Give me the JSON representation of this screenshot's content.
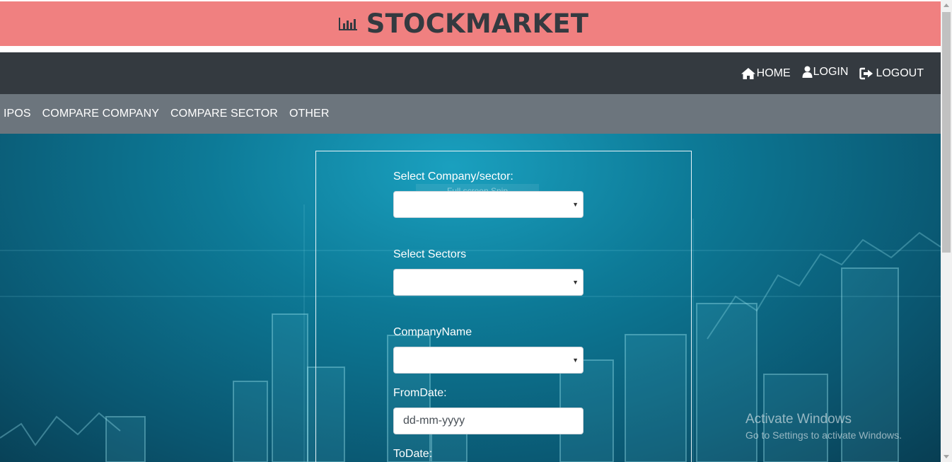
{
  "brand": {
    "title": "STOCKMARKET",
    "icon": "bar-chart-icon",
    "color": "#f08080"
  },
  "top_nav": [
    {
      "label": "HOME",
      "icon": "home-icon"
    },
    {
      "label": "LOGIN",
      "icon": "user-icon"
    },
    {
      "label": "LOGOUT",
      "icon": "sign-out-icon"
    }
  ],
  "sub_nav": [
    "IPOS",
    "COMPARE COMPANY",
    "COMPARE SECTOR",
    "OTHER"
  ],
  "form": {
    "company_sector_label": "Select Company/sector:",
    "company_sector_value": "",
    "ghost_text": "Full screen Snip",
    "sectors_label": "Select Sectors",
    "sectors_value": "",
    "company_name_label": "CompanyName",
    "company_name_value": "",
    "from_date_label": "FromDate:",
    "from_date_placeholder": "dd-mm-yyyy",
    "to_date_label": "ToDate:"
  },
  "watermark": {
    "title": "Activate Windows",
    "subtitle": "Go to Settings to activate Windows."
  },
  "colors": {
    "header_dark": "#343a40",
    "sub_nav": "#6c757d",
    "hero": "#0d7a97"
  }
}
